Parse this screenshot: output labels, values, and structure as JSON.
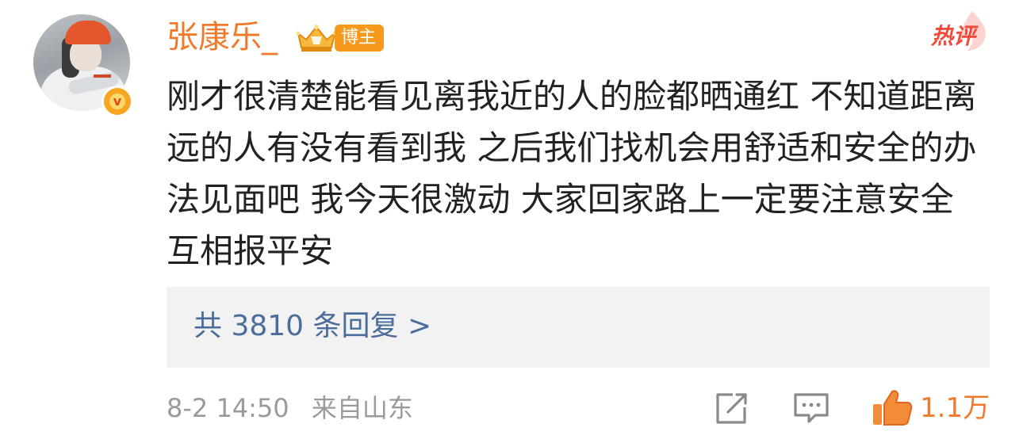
{
  "comment": {
    "username": "张康乐_",
    "blogger_tag": "博主",
    "hot_label": "热评",
    "content": "刚才很清楚能看见离我近的人的脸都晒通红 不知道距离远的人有没有看到我  之后我们找机会用舒适和安全的办法见面吧 我今天很激动 大家回家路上一定要注意安全 互相报平安",
    "replies_link": "共 3810 条回复 >",
    "date": "8-2 14:50",
    "location": "来自山东",
    "like_count": "1.1万",
    "verified_badge": "v",
    "icons": {
      "share": "share-icon",
      "comment": "comment-icon",
      "like": "thumbs-up-icon",
      "crown": "crown-icon",
      "hot": "flame-icon"
    }
  },
  "colors": {
    "username": "#f07a2b",
    "blogger_tag_bg": "#f59a1d",
    "hot": "#f04a3a",
    "link": "#4b6d9b",
    "meta": "#9a9a9a",
    "like": "#f07a2b"
  }
}
